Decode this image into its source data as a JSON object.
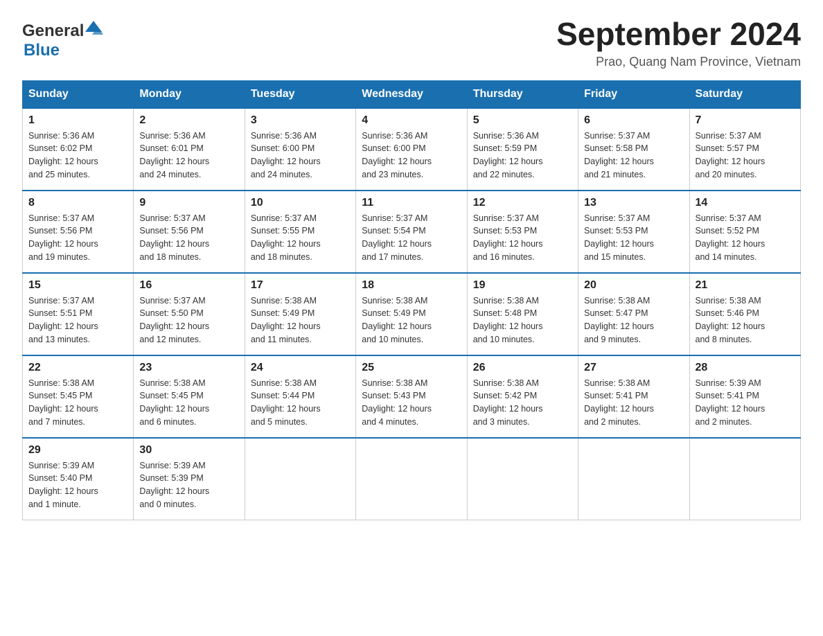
{
  "header": {
    "logo_general": "General",
    "logo_blue": "Blue",
    "title": "September 2024",
    "subtitle": "Prao, Quang Nam Province, Vietnam"
  },
  "days_of_week": [
    "Sunday",
    "Monday",
    "Tuesday",
    "Wednesday",
    "Thursday",
    "Friday",
    "Saturday"
  ],
  "weeks": [
    [
      {
        "day": "1",
        "sunrise": "5:36 AM",
        "sunset": "6:02 PM",
        "daylight": "12 hours and 25 minutes."
      },
      {
        "day": "2",
        "sunrise": "5:36 AM",
        "sunset": "6:01 PM",
        "daylight": "12 hours and 24 minutes."
      },
      {
        "day": "3",
        "sunrise": "5:36 AM",
        "sunset": "6:00 PM",
        "daylight": "12 hours and 24 minutes."
      },
      {
        "day": "4",
        "sunrise": "5:36 AM",
        "sunset": "6:00 PM",
        "daylight": "12 hours and 23 minutes."
      },
      {
        "day": "5",
        "sunrise": "5:36 AM",
        "sunset": "5:59 PM",
        "daylight": "12 hours and 22 minutes."
      },
      {
        "day": "6",
        "sunrise": "5:37 AM",
        "sunset": "5:58 PM",
        "daylight": "12 hours and 21 minutes."
      },
      {
        "day": "7",
        "sunrise": "5:37 AM",
        "sunset": "5:57 PM",
        "daylight": "12 hours and 20 minutes."
      }
    ],
    [
      {
        "day": "8",
        "sunrise": "5:37 AM",
        "sunset": "5:56 PM",
        "daylight": "12 hours and 19 minutes."
      },
      {
        "day": "9",
        "sunrise": "5:37 AM",
        "sunset": "5:56 PM",
        "daylight": "12 hours and 18 minutes."
      },
      {
        "day": "10",
        "sunrise": "5:37 AM",
        "sunset": "5:55 PM",
        "daylight": "12 hours and 18 minutes."
      },
      {
        "day": "11",
        "sunrise": "5:37 AM",
        "sunset": "5:54 PM",
        "daylight": "12 hours and 17 minutes."
      },
      {
        "day": "12",
        "sunrise": "5:37 AM",
        "sunset": "5:53 PM",
        "daylight": "12 hours and 16 minutes."
      },
      {
        "day": "13",
        "sunrise": "5:37 AM",
        "sunset": "5:53 PM",
        "daylight": "12 hours and 15 minutes."
      },
      {
        "day": "14",
        "sunrise": "5:37 AM",
        "sunset": "5:52 PM",
        "daylight": "12 hours and 14 minutes."
      }
    ],
    [
      {
        "day": "15",
        "sunrise": "5:37 AM",
        "sunset": "5:51 PM",
        "daylight": "12 hours and 13 minutes."
      },
      {
        "day": "16",
        "sunrise": "5:37 AM",
        "sunset": "5:50 PM",
        "daylight": "12 hours and 12 minutes."
      },
      {
        "day": "17",
        "sunrise": "5:38 AM",
        "sunset": "5:49 PM",
        "daylight": "12 hours and 11 minutes."
      },
      {
        "day": "18",
        "sunrise": "5:38 AM",
        "sunset": "5:49 PM",
        "daylight": "12 hours and 10 minutes."
      },
      {
        "day": "19",
        "sunrise": "5:38 AM",
        "sunset": "5:48 PM",
        "daylight": "12 hours and 10 minutes."
      },
      {
        "day": "20",
        "sunrise": "5:38 AM",
        "sunset": "5:47 PM",
        "daylight": "12 hours and 9 minutes."
      },
      {
        "day": "21",
        "sunrise": "5:38 AM",
        "sunset": "5:46 PM",
        "daylight": "12 hours and 8 minutes."
      }
    ],
    [
      {
        "day": "22",
        "sunrise": "5:38 AM",
        "sunset": "5:45 PM",
        "daylight": "12 hours and 7 minutes."
      },
      {
        "day": "23",
        "sunrise": "5:38 AM",
        "sunset": "5:45 PM",
        "daylight": "12 hours and 6 minutes."
      },
      {
        "day": "24",
        "sunrise": "5:38 AM",
        "sunset": "5:44 PM",
        "daylight": "12 hours and 5 minutes."
      },
      {
        "day": "25",
        "sunrise": "5:38 AM",
        "sunset": "5:43 PM",
        "daylight": "12 hours and 4 minutes."
      },
      {
        "day": "26",
        "sunrise": "5:38 AM",
        "sunset": "5:42 PM",
        "daylight": "12 hours and 3 minutes."
      },
      {
        "day": "27",
        "sunrise": "5:38 AM",
        "sunset": "5:41 PM",
        "daylight": "12 hours and 2 minutes."
      },
      {
        "day": "28",
        "sunrise": "5:39 AM",
        "sunset": "5:41 PM",
        "daylight": "12 hours and 2 minutes."
      }
    ],
    [
      {
        "day": "29",
        "sunrise": "5:39 AM",
        "sunset": "5:40 PM",
        "daylight": "12 hours and 1 minute."
      },
      {
        "day": "30",
        "sunrise": "5:39 AM",
        "sunset": "5:39 PM",
        "daylight": "12 hours and 0 minutes."
      },
      null,
      null,
      null,
      null,
      null
    ]
  ]
}
